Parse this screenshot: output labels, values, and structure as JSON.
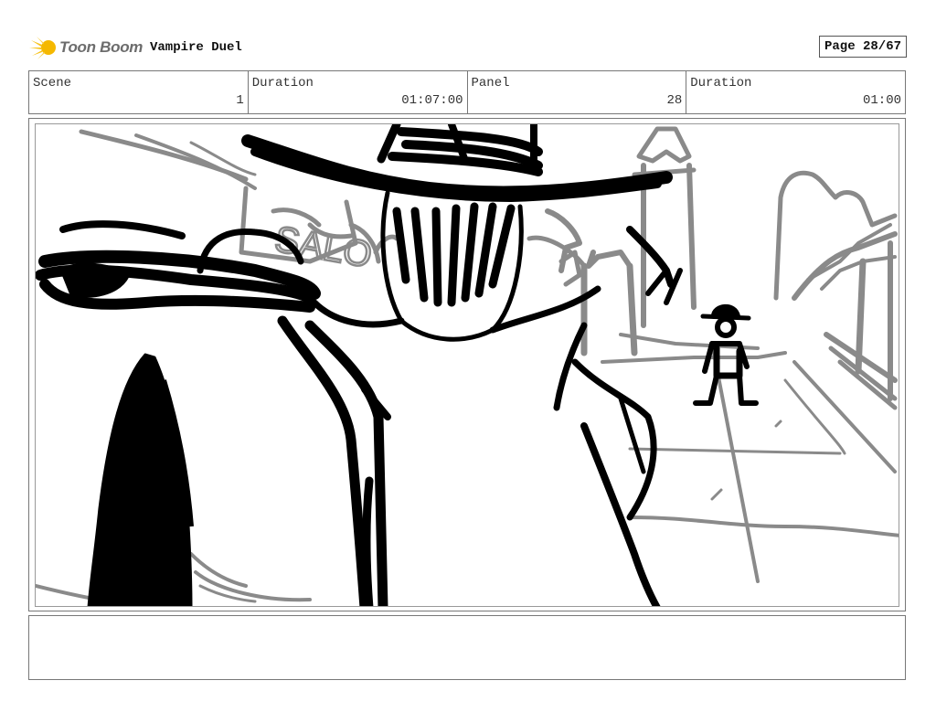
{
  "header": {
    "logo_text": "Toon Boom",
    "project_title": "Vampire Duel",
    "page_label": "Page 28/67"
  },
  "info": {
    "scene_label": "Scene",
    "scene_value": "1",
    "duration_label": "Duration",
    "duration_value": "01:07:00",
    "panel_label": "Panel",
    "panel_value": "28",
    "panel_duration_label": "Duration",
    "panel_duration_value": "01:00"
  },
  "panel": {
    "sign_text": "SALO"
  },
  "notes": {
    "text": ""
  },
  "colors": {
    "logo_accent": "#f5b800",
    "ink": "#000000",
    "sketch_gray": "#8a8a8a"
  }
}
